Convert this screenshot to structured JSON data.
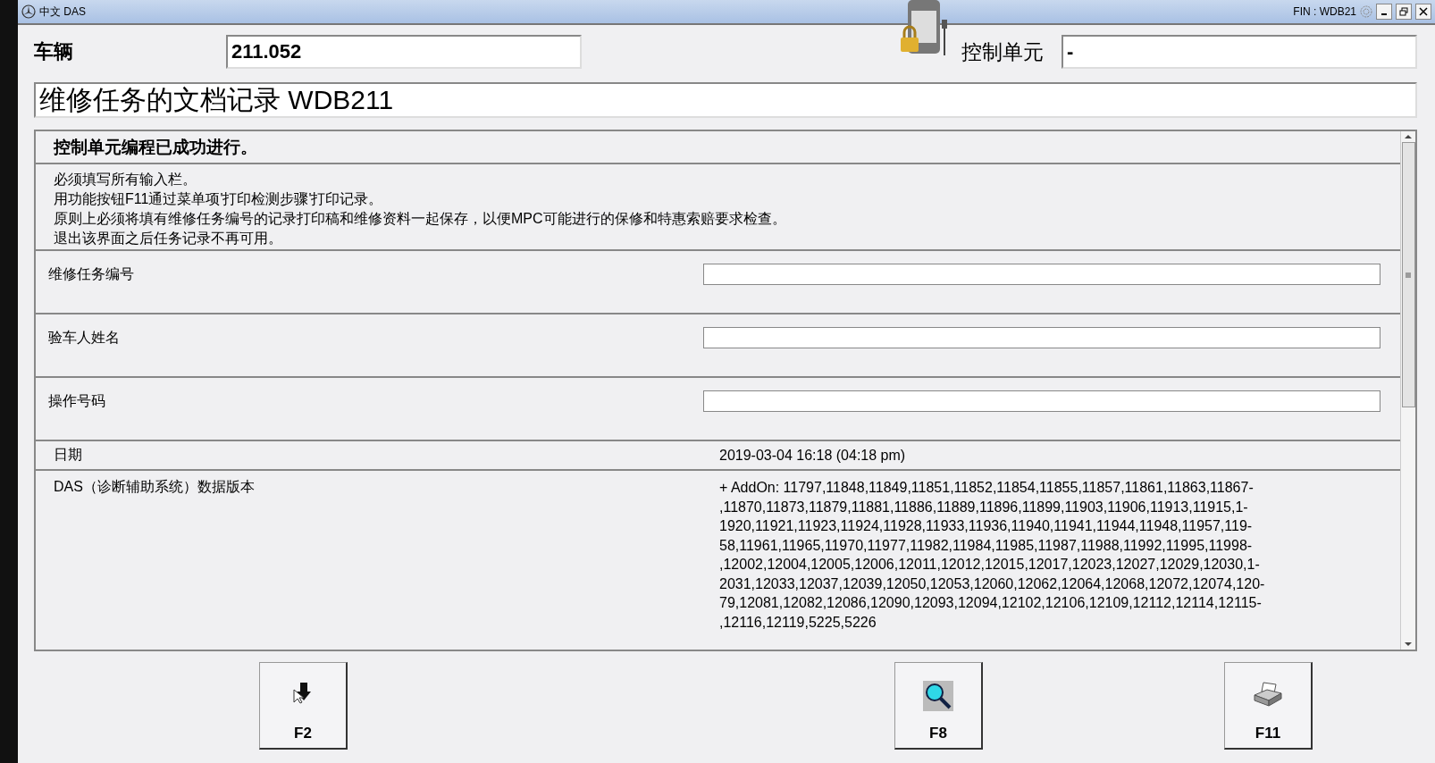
{
  "window": {
    "title": "中文 DAS",
    "fin": "FIN : WDB21"
  },
  "header": {
    "vehicle_label": "车辆",
    "vehicle_value": "211.052",
    "control_unit_label": "控制单元",
    "control_unit_value": "-"
  },
  "page_title": "维修任务的文档记录 WDB211",
  "panel": {
    "heading": "控制单元编程已成功进行。",
    "instructions": [
      "必须填写所有输入栏。",
      "用功能按钮F11通过菜单项'打印检测步骤'打印记录。",
      "原则上必须将填有维修任务编号的记录打印稿和维修资料一起保存，以便MPC可能进行的保修和特惠索赔要求检查。",
      "退出该界面之后任务记录不再可用。"
    ],
    "fields": [
      {
        "label": "维修任务编号"
      },
      {
        "label": "验车人姓名"
      },
      {
        "label": "操作号码"
      }
    ],
    "date_label": "日期",
    "date_value": "2019-03-04 16:18 (04:18 pm)",
    "version_label": "DAS（诊断辅助系统）数据版本",
    "version_lines": [
      "+ AddOn: 11797,11848,11849,11851,11852,11854,11855,11857,11861,11863,11867-",
      ",11870,11873,11879,11881,11886,11889,11896,11899,11903,11906,11913,11915,1-",
      "1920,11921,11923,11924,11928,11933,11936,11940,11941,11944,11948,11957,119-",
      "58,11961,11965,11970,11977,11982,11984,11985,11987,11988,11992,11995,11998-",
      ",12002,12004,12005,12006,12011,12012,12015,12017,12023,12027,12029,12030,1-",
      "2031,12033,12037,12039,12050,12053,12060,12062,12064,12068,12072,12074,120-",
      "79,12081,12082,12086,12090,12093,12094,12102,12106,12109,12112,12114,12115-",
      ",12116,12119,5225,5226"
    ]
  },
  "buttons": [
    {
      "label": "F2",
      "kind": "pointer"
    },
    {
      "label": "F8",
      "kind": "search"
    },
    {
      "label": "F11",
      "kind": "print"
    }
  ]
}
